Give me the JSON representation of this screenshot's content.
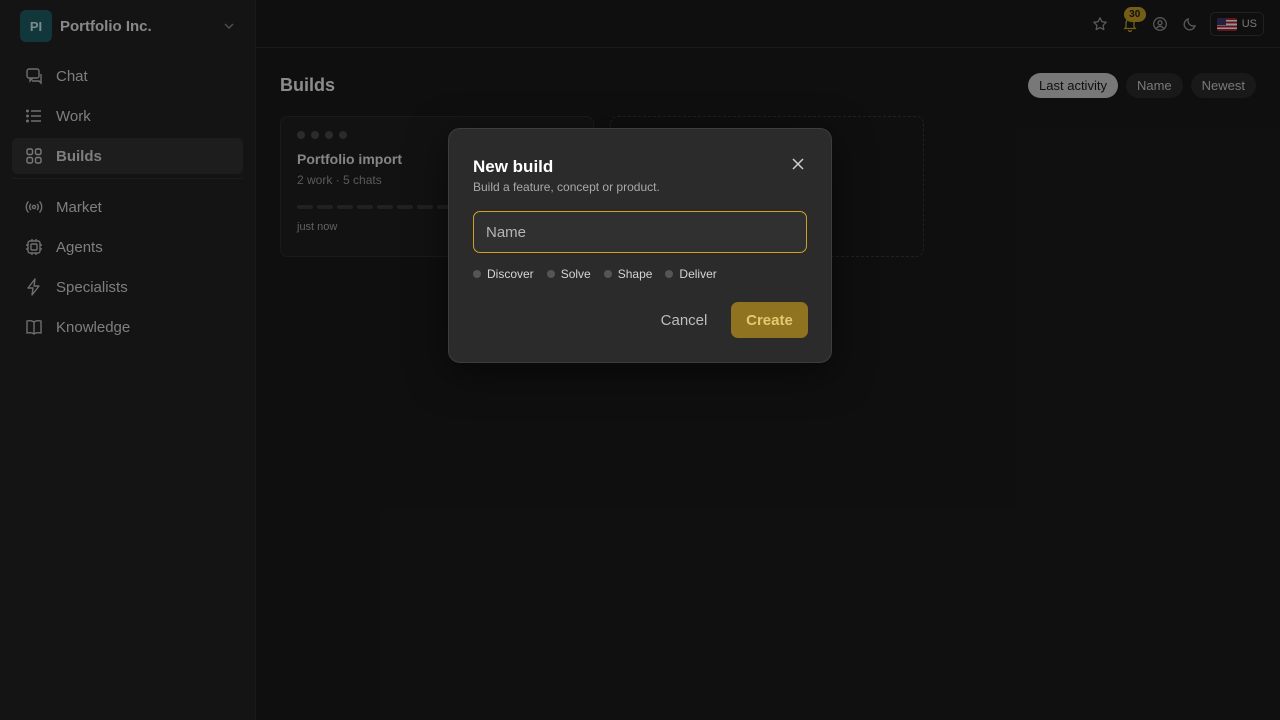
{
  "org": {
    "initials": "PI",
    "name": "Portfolio Inc."
  },
  "sidebar": {
    "items": [
      {
        "label": "Chat",
        "icon": "chat-icon"
      },
      {
        "label": "Work",
        "icon": "list-icon"
      },
      {
        "label": "Builds",
        "icon": "grid-icon",
        "active": true
      },
      {
        "label": "Market",
        "icon": "broadcast-icon"
      },
      {
        "label": "Agents",
        "icon": "chip-icon"
      },
      {
        "label": "Specialists",
        "icon": "bolt-icon"
      },
      {
        "label": "Knowledge",
        "icon": "book-icon"
      }
    ]
  },
  "topbar": {
    "notifications_count": "30",
    "locale": "US"
  },
  "main": {
    "title": "Builds",
    "sort_options": [
      "Last activity",
      "Name",
      "Newest"
    ],
    "active_sort": "Last activity",
    "cards": [
      {
        "title": "Portfolio import",
        "meta": "2 work · 5 chats",
        "time": "just now"
      }
    ]
  },
  "modal": {
    "title": "New build",
    "subtitle": "Build a feature, concept or product.",
    "name_placeholder": "Name",
    "name_value": "",
    "phases": [
      "Discover",
      "Solve",
      "Shape",
      "Deliver"
    ],
    "cancel_label": "Cancel",
    "create_label": "Create"
  },
  "colors": {
    "accent": "#c9a227",
    "create_button_bg": "#8f7320",
    "org_avatar_bg": "#1f5f66"
  }
}
